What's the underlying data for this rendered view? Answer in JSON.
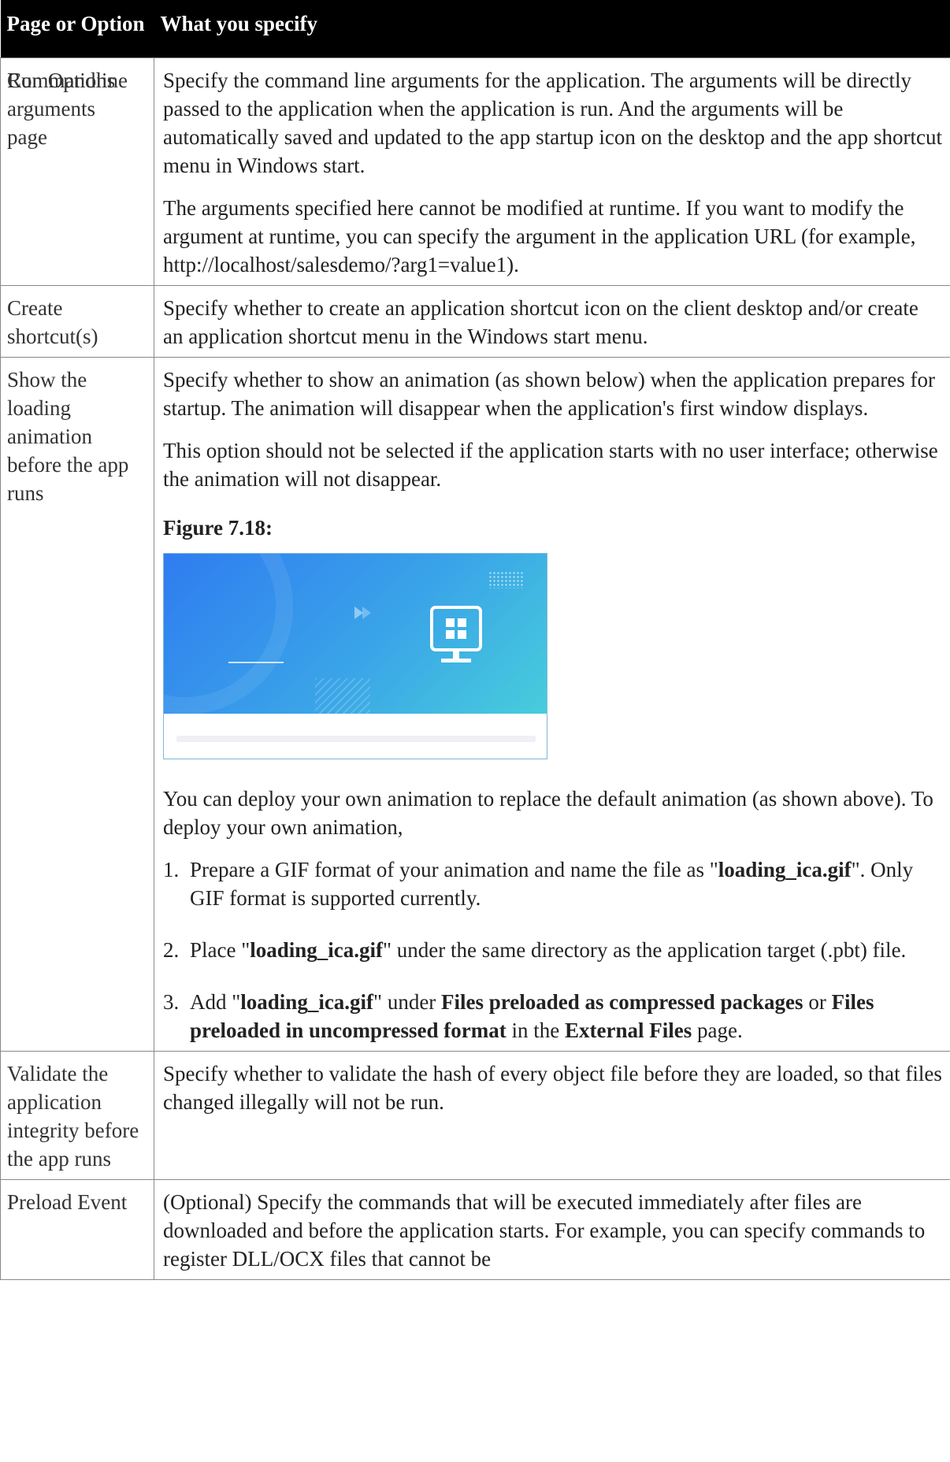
{
  "header": {
    "col1": "Page or Option",
    "col2": "What you specify"
  },
  "rows": {
    "commandline": {
      "option_a": "Run Options",
      "option_b": "Commandline arguments",
      "option_c": "page",
      "p1": "Specify the command line arguments for the application. The arguments will be directly passed to the application when the application is run. And the arguments will be automatically saved and updated to the app startup icon on the desktop and the app shortcut menu in Windows start.",
      "p2": "The arguments specified here cannot be modified at runtime. If you want to modify the argument at runtime, you can specify the argument in the application URL (for example, http://localhost/salesdemo/?arg1=value1)."
    },
    "shortcut": {
      "option": "Create shortcut(s)",
      "p1": "Specify whether to create an application shortcut icon on the client desktop and/or create an application shortcut menu in the Windows start menu."
    },
    "loading": {
      "option": "Show the loading animation before the app runs",
      "p1": "Specify whether to show an animation (as shown below) when the application prepares for startup. The animation will disappear when the application's first window displays.",
      "p2": "This option should not be selected if the application starts with no user interface; otherwise the animation will not disappear.",
      "figure_title": "Figure 7.18:",
      "p3": "You can deploy your own animation to replace the default animation (as shown above). To deploy your own animation,",
      "steps": {
        "s1": {
          "num": "1.",
          "t1": "Prepare a GIF format of your animation and name the file as \"",
          "b1": "loading_ica.gif",
          "t2": "\". Only GIF format is supported currently."
        },
        "s2": {
          "num": "2.",
          "t1": "Place \"",
          "b1": "loading_ica.gif",
          "t2": "\" under the same directory as the application target (.pbt) file."
        },
        "s3": {
          "num": "3.",
          "t1": "Add \"",
          "b1": "loading_ica.gif",
          "t2": "\" under ",
          "b2": "Files preloaded as compressed packages",
          "t3": " or ",
          "b3": "Files preloaded in uncompressed format",
          "t4": " in the ",
          "b4": "External Files",
          "t5": " page."
        }
      }
    },
    "validate": {
      "option": "Validate the application integrity before the app runs",
      "p1": "Specify whether to validate the hash of every object file before they are loaded, so that files changed illegally will not be run."
    },
    "preload": {
      "option": "Preload Event",
      "p1": "(Optional) Specify the commands that will be executed immediately after files are downloaded and before the application starts. For example, you can specify commands to register DLL/OCX files that cannot be"
    }
  },
  "colors": {
    "header_bg": "#000000",
    "border": "#888888",
    "figure_gradient_start": "#2f7cf0",
    "figure_gradient_end": "#47cddb"
  },
  "icons": [
    "play-arrows-icon",
    "monitor-grid-icon"
  ]
}
